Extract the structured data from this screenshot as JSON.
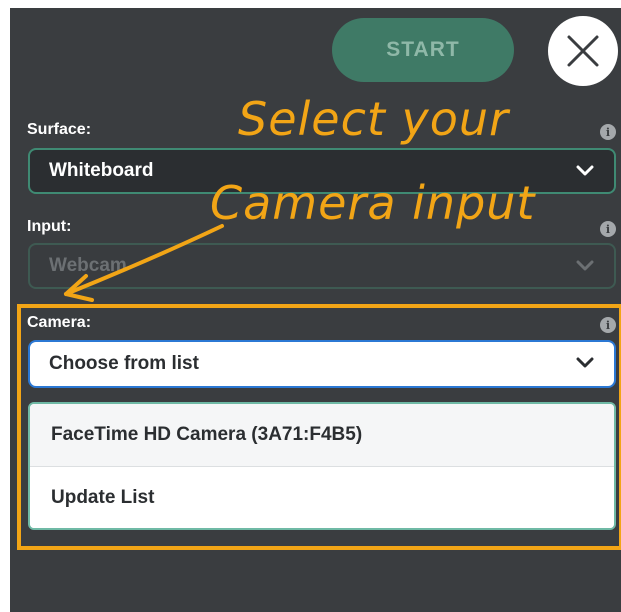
{
  "header": {
    "start_label": "START",
    "close_icon": "close-icon"
  },
  "surface": {
    "label": "Surface:",
    "value": "Whiteboard"
  },
  "input": {
    "label": "Input:",
    "value": "Webcam"
  },
  "camera": {
    "label": "Camera:",
    "value": "Choose from list",
    "options": [
      "FaceTime HD Camera (3A71:F4B5)",
      "Update List"
    ]
  },
  "annotation": {
    "line1": "Select your",
    "line2": "Camera input"
  },
  "colors": {
    "panel_bg": "#3a3d40",
    "accent_green": "#3f7a66",
    "highlight_orange": "#f2a516",
    "focus_blue": "#2b78d4"
  }
}
